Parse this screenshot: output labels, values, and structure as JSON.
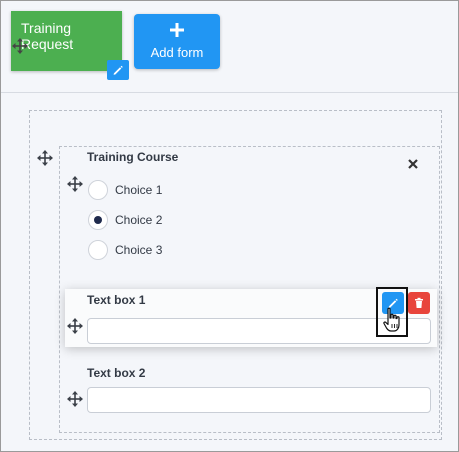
{
  "toolbar": {
    "form_tile_title": "Training Request",
    "add_form_label": "Add form"
  },
  "section": {
    "title": "Training Course",
    "choices": [
      "Choice 1",
      "Choice 2",
      "Choice 3"
    ],
    "selected_choice": "Choice 2"
  },
  "fields": [
    {
      "label": "Text box 1",
      "value": ""
    },
    {
      "label": "Text box 2",
      "value": ""
    }
  ],
  "colors": {
    "form_tile": "#4caf50",
    "primary": "#2196f3",
    "danger": "#e8453c",
    "background": "#f4f6fa"
  }
}
